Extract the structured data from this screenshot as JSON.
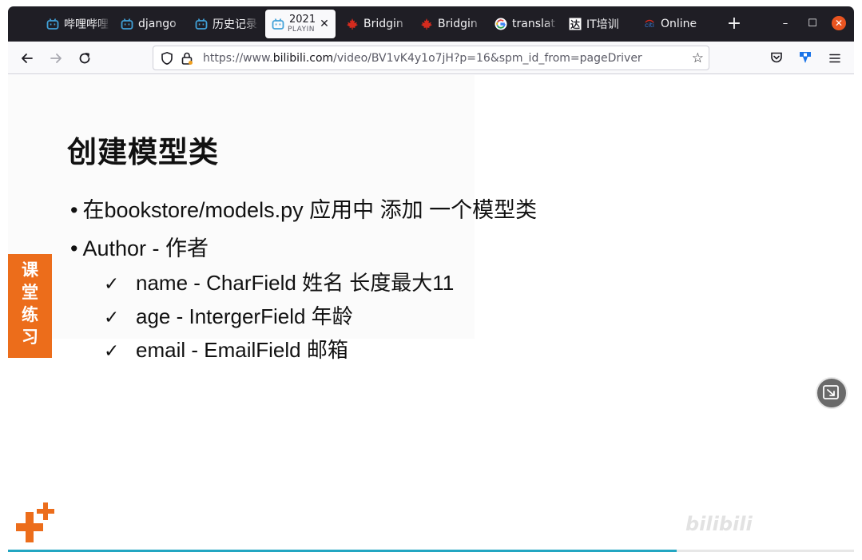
{
  "tabs": [
    {
      "label": "哔哩哔哩",
      "icon": "bilibili-icon",
      "active": false
    },
    {
      "label": "django",
      "icon": "bilibili-icon",
      "active": false
    },
    {
      "label": "历史记录",
      "icon": "bilibili-icon",
      "active": false
    },
    {
      "label": "2021",
      "sublabel": "PLAYIN",
      "icon": "bilibili-icon",
      "active": true
    },
    {
      "label": "Bridgin",
      "icon": "maple-leaf-icon",
      "active": false
    },
    {
      "label": "Bridgin",
      "icon": "maple-leaf-icon",
      "active": false
    },
    {
      "label": "translat",
      "icon": "google-icon",
      "active": false
    },
    {
      "label": "IT培训",
      "icon": "da-icon",
      "active": false
    },
    {
      "label": "Online",
      "icon": "citi-icon",
      "active": false
    }
  ],
  "newtab_label": "+",
  "window": {
    "minimize": "–",
    "maximize": "☐",
    "close": "✕"
  },
  "nav": {
    "url_prefix": "https://www.",
    "url_host": "bilibili.com",
    "url_path": "/video/BV1vK4y1o7jH?p=16&spm_id_from=pageDriver"
  },
  "slide": {
    "title": "创建模型类",
    "bullets": [
      "在bookstore/models.py  应用中 添加 一个模型类",
      "Author - 作者"
    ],
    "checks": [
      "name - CharField 姓名  长度最大11",
      "age - IntergerField 年龄",
      "email - EmailField  邮箱"
    ],
    "badge": [
      "课",
      "堂",
      "练",
      "习"
    ],
    "watermark": "bilibili"
  },
  "player": {
    "progress": 0.79
  },
  "colors": {
    "accent_orange": "#ec6d1b",
    "progress": "#23a6c2",
    "tabbar": "#1f1e25",
    "close": "#e95420"
  }
}
